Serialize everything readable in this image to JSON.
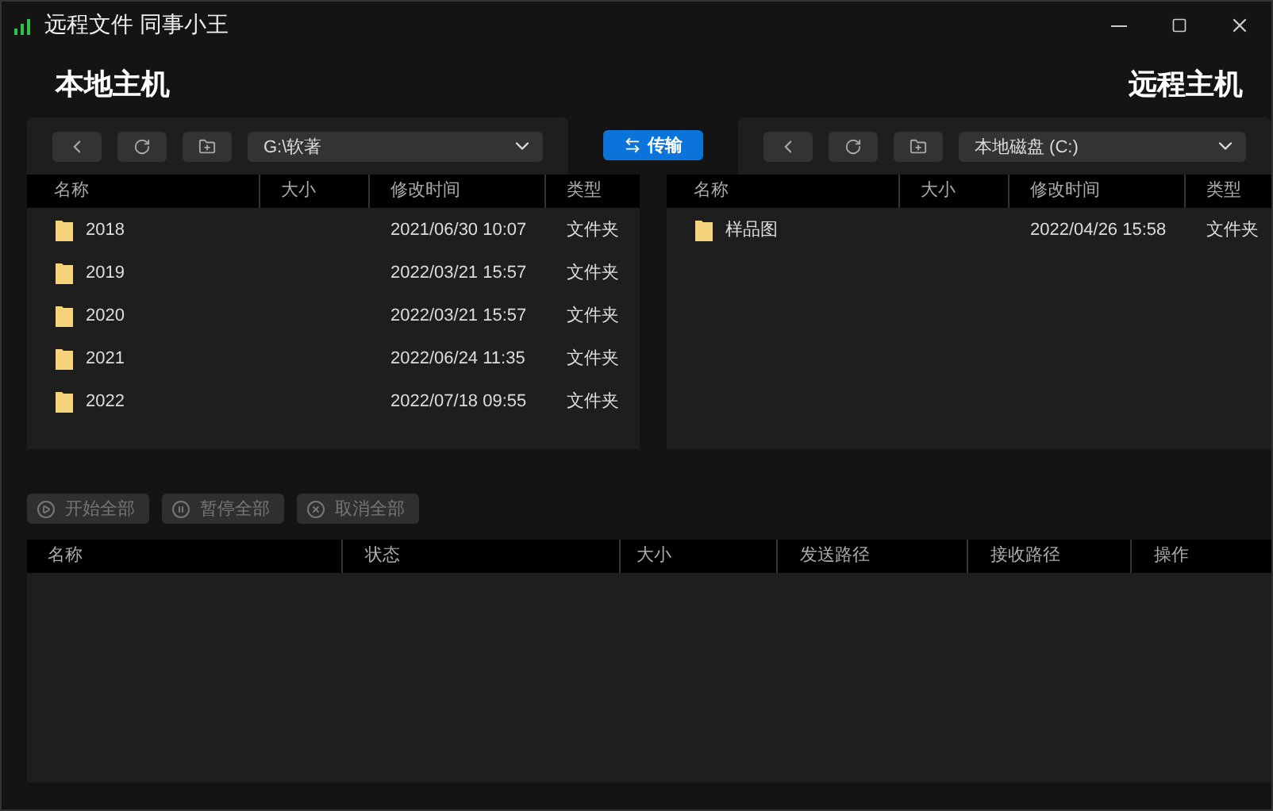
{
  "window": {
    "title": "远程文件 同事小王"
  },
  "local": {
    "heading": "本地主机",
    "path": "G:\\软著",
    "columns": [
      "名称",
      "大小",
      "修改时间",
      "类型"
    ],
    "rows": [
      {
        "name": "2018",
        "size": "",
        "modified": "2021/06/30 10:07",
        "type": "文件夹"
      },
      {
        "name": "2019",
        "size": "",
        "modified": "2022/03/21 15:57",
        "type": "文件夹"
      },
      {
        "name": "2020",
        "size": "",
        "modified": "2022/03/21 15:57",
        "type": "文件夹"
      },
      {
        "name": "2021",
        "size": "",
        "modified": "2022/06/24 11:35",
        "type": "文件夹"
      },
      {
        "name": "2022",
        "size": "",
        "modified": "2022/07/18 09:55",
        "type": "文件夹"
      }
    ]
  },
  "transfer_button": "传输",
  "remote": {
    "heading": "远程主机",
    "path": "本地磁盘 (C:)",
    "columns": [
      "名称",
      "大小",
      "修改时间",
      "类型"
    ],
    "rows": [
      {
        "name": "样品图",
        "size": "",
        "modified": "2022/04/26 15:58",
        "type": "文件夹"
      }
    ]
  },
  "queue_actions": [
    {
      "label": "开始全部",
      "kind": "play",
      "disabled": true
    },
    {
      "label": "暂停全部",
      "kind": "pause",
      "disabled": true
    },
    {
      "label": "取消全部",
      "kind": "cancel",
      "disabled": true
    }
  ],
  "queue": {
    "columns": [
      "名称",
      "状态",
      "大小",
      "发送路径",
      "接收路径",
      "操作"
    ]
  }
}
